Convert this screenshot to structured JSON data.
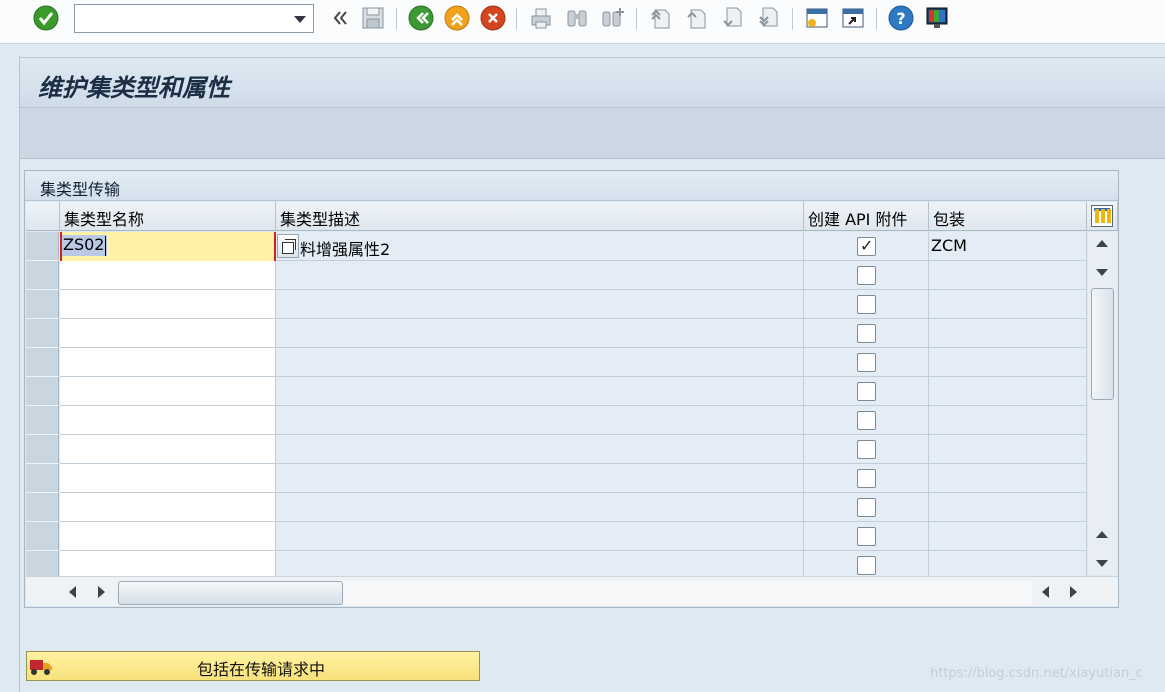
{
  "toolbar": {
    "command_field_value": "",
    "icons": [
      "enter-icon",
      "back-double-icon",
      "save-icon",
      "back-icon",
      "exit-icon",
      "cancel-icon",
      "print-icon",
      "find-icon",
      "find-next-icon",
      "first-page-icon",
      "previous-page-icon",
      "next-page-icon",
      "last-page-icon",
      "new-session-icon",
      "shortcut-icon",
      "help-icon",
      "customize-layout-icon"
    ]
  },
  "screen": {
    "title": "维护集类型和属性"
  },
  "table": {
    "title": "集类型传输",
    "columns": {
      "name": "集类型名称",
      "desc": "集类型描述",
      "api": "创建 API 附件",
      "pkg": "包装"
    },
    "rows": [
      {
        "name": "ZS02",
        "desc": "料增强属性2",
        "api": true,
        "pkg": "ZCM"
      },
      {
        "name": "",
        "desc": "",
        "api": false,
        "pkg": ""
      },
      {
        "name": "",
        "desc": "",
        "api": false,
        "pkg": ""
      },
      {
        "name": "",
        "desc": "",
        "api": false,
        "pkg": ""
      },
      {
        "name": "",
        "desc": "",
        "api": false,
        "pkg": ""
      },
      {
        "name": "",
        "desc": "",
        "api": false,
        "pkg": ""
      },
      {
        "name": "",
        "desc": "",
        "api": false,
        "pkg": ""
      },
      {
        "name": "",
        "desc": "",
        "api": false,
        "pkg": ""
      },
      {
        "name": "",
        "desc": "",
        "api": false,
        "pkg": ""
      },
      {
        "name": "",
        "desc": "",
        "api": false,
        "pkg": ""
      },
      {
        "name": "",
        "desc": "",
        "api": false,
        "pkg": ""
      },
      {
        "name": "",
        "desc": "",
        "api": false,
        "pkg": ""
      }
    ]
  },
  "transport_button": {
    "label": "包括在传输请求中"
  },
  "watermark": "https://blog.csdn.net/xiayutian_c"
}
